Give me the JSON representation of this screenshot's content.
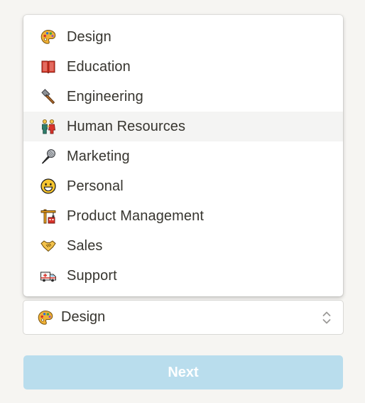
{
  "dropdown": {
    "items": [
      {
        "label": "Design",
        "icon": "palette-icon"
      },
      {
        "label": "Education",
        "icon": "books-icon"
      },
      {
        "label": "Engineering",
        "icon": "hammer-icon"
      },
      {
        "label": "Human Resources",
        "icon": "people-holding-hands-icon"
      },
      {
        "label": "Marketing",
        "icon": "microphone-icon"
      },
      {
        "label": "Personal",
        "icon": "grinning-face-icon"
      },
      {
        "label": "Product Management",
        "icon": "construction-crane-icon"
      },
      {
        "label": "Sales",
        "icon": "handshake-icon"
      },
      {
        "label": "Support",
        "icon": "ambulance-icon"
      }
    ],
    "highlighted_index": 3
  },
  "select": {
    "value": "Design",
    "icon": "palette-icon"
  },
  "next_button": {
    "label": "Next",
    "enabled": false
  },
  "colors": {
    "background": "#f6f5f2",
    "text": "#37352f",
    "button_disabled": "#b9dded"
  }
}
